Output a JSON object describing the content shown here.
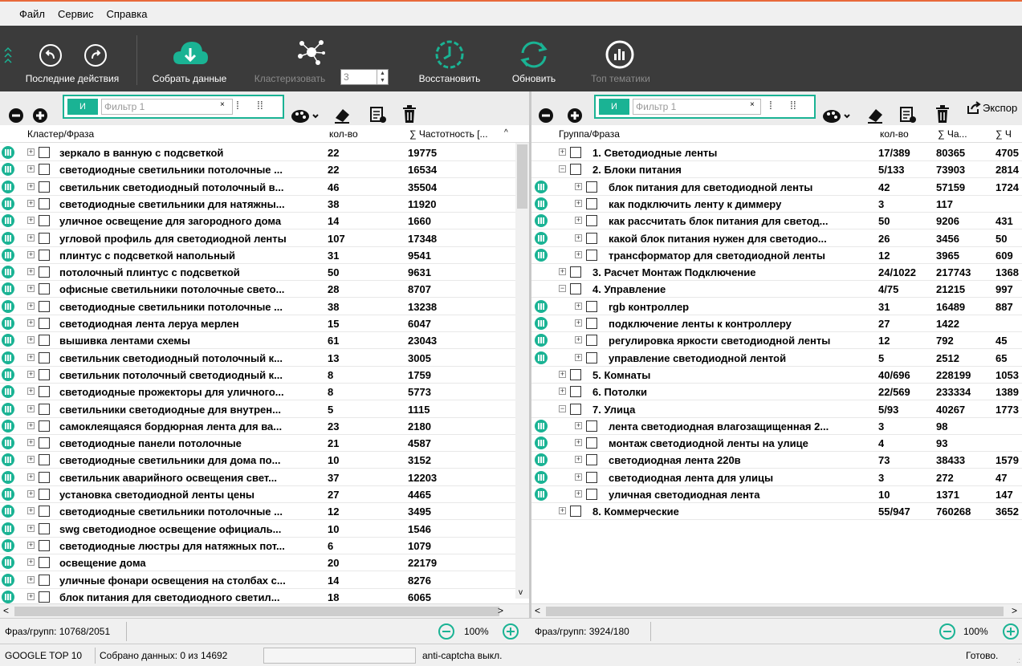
{
  "menu": {
    "file": "Файл",
    "service": "Сервис",
    "help": "Справка"
  },
  "toolbar": {
    "recent": "Последние действия",
    "collect": "Собрать данные",
    "cluster": "Кластеризовать",
    "cluster_value": "3",
    "restore": "Восстановить",
    "refresh": "Обновить",
    "top_themes": "Топ тематики"
  },
  "left": {
    "filter_tag": "И",
    "filter_placeholder": "Фильтр 1",
    "col_phrase": "Кластер/Фраза",
    "col_count": "кол-во",
    "col_freq": "∑  Частотность [...",
    "rows": [
      {
        "phrase": "зеркало в ванную с подсветкой",
        "count": "22",
        "freq": "19775"
      },
      {
        "phrase": "светодиодные светильники потолочные ...",
        "count": "22",
        "freq": "16534"
      },
      {
        "phrase": "светильник светодиодный потолочный в...",
        "count": "46",
        "freq": "35504"
      },
      {
        "phrase": "светодиодные светильники для натяжны...",
        "count": "38",
        "freq": "11920"
      },
      {
        "phrase": "уличное освещение для загородного дома",
        "count": "14",
        "freq": "1660"
      },
      {
        "phrase": "угловой профиль для светодиодной ленты",
        "count": "107",
        "freq": "17348"
      },
      {
        "phrase": "плинтус с подсветкой напольный",
        "count": "31",
        "freq": "9541"
      },
      {
        "phrase": "потолочный плинтус с подсветкой",
        "count": "50",
        "freq": "9631"
      },
      {
        "phrase": "офисные светильники потолочные свето...",
        "count": "28",
        "freq": "8707"
      },
      {
        "phrase": "светодиодные светильники потолочные ...",
        "count": "38",
        "freq": "13238"
      },
      {
        "phrase": "светодиодная лента леруа мерлен",
        "count": "15",
        "freq": "6047"
      },
      {
        "phrase": "вышивка лентами схемы",
        "count": "61",
        "freq": "23043"
      },
      {
        "phrase": "светильник светодиодный потолочный к...",
        "count": "13",
        "freq": "3005"
      },
      {
        "phrase": "светильник потолочный светодиодный к...",
        "count": "8",
        "freq": "1759"
      },
      {
        "phrase": "светодиодные прожекторы для уличного...",
        "count": "8",
        "freq": "5773"
      },
      {
        "phrase": "светильники светодиодные для внутрен...",
        "count": "5",
        "freq": "1115"
      },
      {
        "phrase": "самоклеящаяся бордюрная лента для ва...",
        "count": "23",
        "freq": "2180"
      },
      {
        "phrase": "светодиодные панели потолочные",
        "count": "21",
        "freq": "4587"
      },
      {
        "phrase": "светодиодные светильники для дома по...",
        "count": "10",
        "freq": "3152"
      },
      {
        "phrase": "светильник аварийного освещения свет...",
        "count": "37",
        "freq": "12203"
      },
      {
        "phrase": "установка светодиодной ленты цены",
        "count": "27",
        "freq": "4465"
      },
      {
        "phrase": "светодиодные светильники потолочные ...",
        "count": "12",
        "freq": "3495"
      },
      {
        "phrase": "swg светодиодное освещение официаль...",
        "count": "10",
        "freq": "1546"
      },
      {
        "phrase": "светодиодные люстры для натяжных пот...",
        "count": "6",
        "freq": "1079"
      },
      {
        "phrase": "освещение дома",
        "count": "20",
        "freq": "22179"
      },
      {
        "phrase": "уличные фонари освещения на столбах с...",
        "count": "14",
        "freq": "8276"
      },
      {
        "phrase": "блок питания для светодиодного светил...",
        "count": "18",
        "freq": "6065"
      }
    ],
    "status_count": "Фраз/групп: 10768/2051",
    "zoom": "100%"
  },
  "right": {
    "filter_tag": "И",
    "filter_placeholder": "Фильтр 1",
    "export": "Экспор",
    "col_phrase": "Группа/Фраза",
    "col_count": "кол-во",
    "col_freq": "∑  Ча...",
    "col_extra": "∑  Ч",
    "rows": [
      {
        "phrase": "1. Светодиодные ленты",
        "count": "17/389",
        "freq": "80365",
        "extra": "4705",
        "level": 0,
        "icon": false
      },
      {
        "phrase": "2. Блоки питания",
        "count": "5/133",
        "freq": "73903",
        "extra": "2814",
        "level": 0,
        "icon": false
      },
      {
        "phrase": "блок питания для светодиодной ленты",
        "count": "42",
        "freq": "57159",
        "extra": "1724",
        "level": 1,
        "icon": true
      },
      {
        "phrase": "как подключить ленту к диммеру",
        "count": "3",
        "freq": "117",
        "extra": "",
        "level": 1,
        "icon": true
      },
      {
        "phrase": "как рассчитать блок питания для светод...",
        "count": "50",
        "freq": "9206",
        "extra": "431",
        "level": 1,
        "icon": true
      },
      {
        "phrase": "какой блок питания нужен для светодио...",
        "count": "26",
        "freq": "3456",
        "extra": "50",
        "level": 1,
        "icon": true
      },
      {
        "phrase": "трансформатор для светодиодной ленты",
        "count": "12",
        "freq": "3965",
        "extra": "609",
        "level": 1,
        "icon": true
      },
      {
        "phrase": "3. Расчет Монтаж Подключение",
        "count": "24/1022",
        "freq": "217743",
        "extra": "1368",
        "level": 0,
        "icon": false
      },
      {
        "phrase": "4. Управление",
        "count": "4/75",
        "freq": "21215",
        "extra": "997",
        "level": 0,
        "icon": false
      },
      {
        "phrase": "rgb контроллер",
        "count": "31",
        "freq": "16489",
        "extra": "887",
        "level": 1,
        "icon": true
      },
      {
        "phrase": "подключение ленты к контроллеру",
        "count": "27",
        "freq": "1422",
        "extra": "",
        "level": 1,
        "icon": true
      },
      {
        "phrase": "регулировка яркости светодиодной ленты",
        "count": "12",
        "freq": "792",
        "extra": "45",
        "level": 1,
        "icon": true
      },
      {
        "phrase": "управление светодиодной лентой",
        "count": "5",
        "freq": "2512",
        "extra": "65",
        "level": 1,
        "icon": true
      },
      {
        "phrase": "5. Комнаты",
        "count": "40/696",
        "freq": "228199",
        "extra": "1053",
        "level": 0,
        "icon": false
      },
      {
        "phrase": "6. Потолки",
        "count": "22/569",
        "freq": "233334",
        "extra": "1389",
        "level": 0,
        "icon": false
      },
      {
        "phrase": "7. Улица",
        "count": "5/93",
        "freq": "40267",
        "extra": "1773",
        "level": 0,
        "icon": false
      },
      {
        "phrase": "лента светодиодная влагозащищенная 2...",
        "count": "3",
        "freq": "98",
        "extra": "",
        "level": 1,
        "icon": true
      },
      {
        "phrase": "монтаж светодиодной ленты на улице",
        "count": "4",
        "freq": "93",
        "extra": "",
        "level": 1,
        "icon": true
      },
      {
        "phrase": "светодиодная лента 220в",
        "count": "73",
        "freq": "38433",
        "extra": "1579",
        "level": 1,
        "icon": true
      },
      {
        "phrase": "светодиодная лента для улицы",
        "count": "3",
        "freq": "272",
        "extra": "47",
        "level": 1,
        "icon": true
      },
      {
        "phrase": "уличная светодиодная лента",
        "count": "10",
        "freq": "1371",
        "extra": "147",
        "level": 1,
        "icon": true
      },
      {
        "phrase": "8. Коммерческие",
        "count": "55/947",
        "freq": "760268",
        "extra": "3652",
        "level": 0,
        "icon": false
      }
    ],
    "status_count": "Фраз/групп: 3924/180",
    "zoom": "100%"
  },
  "status": {
    "engine": "GOOGLE TOP 10",
    "collected": "Собрано данных:  0 из 14692",
    "captcha": "anti-captcha выкл.",
    "ready": "Готово."
  },
  "colors": {
    "accent": "#1ab394",
    "toolbar_bg": "#3b3b3b",
    "menu_border": "#e8693a"
  }
}
